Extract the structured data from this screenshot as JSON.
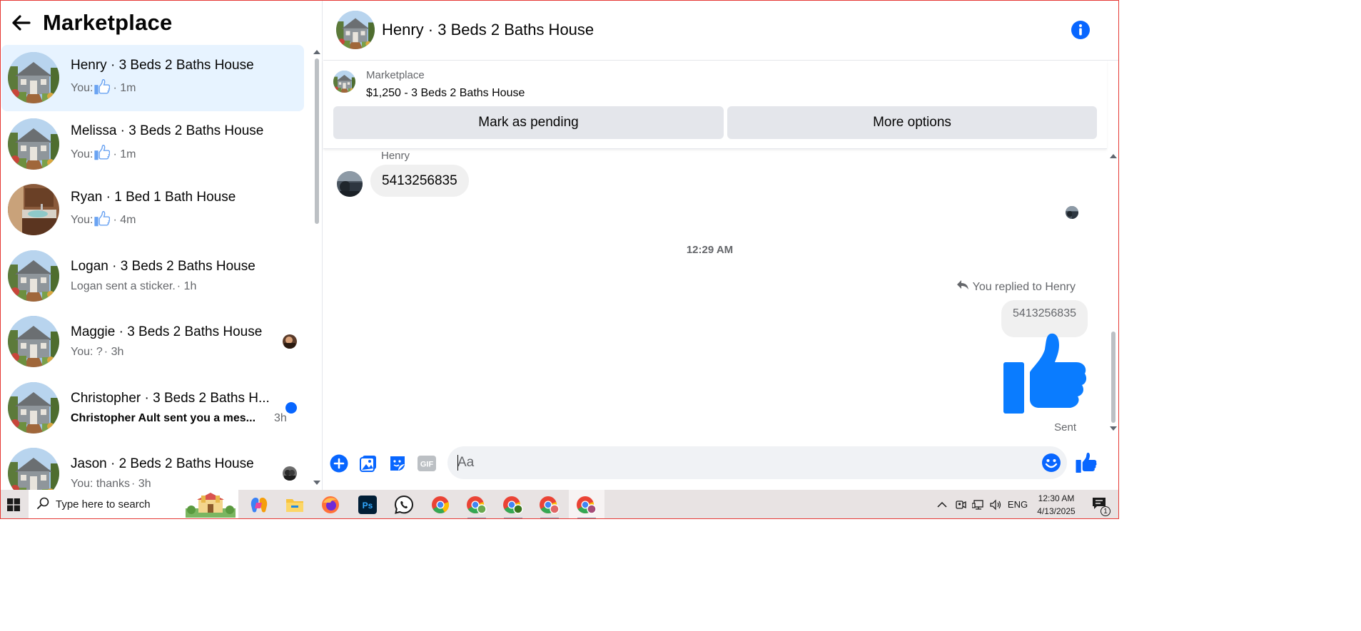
{
  "marketplace": {
    "title": "Marketplace"
  },
  "conversations": [
    {
      "title": "Henry · 3 Beds 2 Baths House",
      "prefix": "You:",
      "like": true,
      "time": "· 1m",
      "active": true
    },
    {
      "title": "Melissa · 3 Beds 2 Baths House",
      "prefix": "You:",
      "like": true,
      "time": "· 1m"
    },
    {
      "title": "Ryan · 1 Bed 1 Bath House",
      "prefix": "You:",
      "like": true,
      "time": "· 4m"
    },
    {
      "title": "Logan · 3 Beds 2 Baths House",
      "prefix": "Logan sent a sticker.",
      "time": "· 1h"
    },
    {
      "title": "Maggie · 3 Beds 2 Baths House",
      "prefix": "You: ?",
      "time": "· 3h"
    },
    {
      "title": "Christopher · 3 Beds 2 Baths H...",
      "prefix": "Christopher Ault sent you a mes...",
      "time": "3h",
      "unread": true
    },
    {
      "title": "Jason · 2 Beds 2 Baths House",
      "prefix": "You: thanks",
      "time": "· 3h"
    }
  ],
  "chat": {
    "title": "Henry · 3 Beds 2 Baths House",
    "listing_label": "Marketplace",
    "listing_price": "$1,250 - 3 Beds 2 Baths House",
    "btn_pending": "Mark as pending",
    "btn_more": "More options",
    "sender": "Henry",
    "incoming_message": "5413256835",
    "timestamp": "12:29 AM",
    "reply_note": "You replied to Henry",
    "replied_text": "5413256835",
    "status": "Sent",
    "input_placeholder": "Aa"
  },
  "taskbar": {
    "search_placeholder": "Type here to search",
    "language": "ENG",
    "time": "12:30 AM",
    "date": "4/13/2025",
    "notification_count": "1"
  },
  "colors": {
    "accent": "#0866ff",
    "active_row": "#e7f3ff",
    "bubble": "#f0f0f0",
    "button_gray": "#e4e6eb"
  },
  "icons": [
    "back-arrow-icon",
    "info-icon",
    "plus-icon",
    "photo-icon",
    "sticker-icon",
    "gif-icon",
    "emoji-icon",
    "like-icon",
    "reply-icon",
    "windows-icon",
    "search-icon"
  ]
}
